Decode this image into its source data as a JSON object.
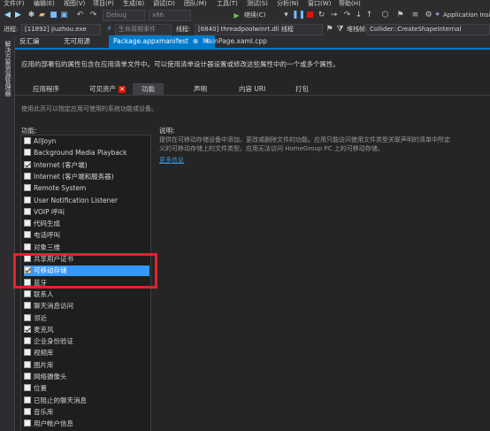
{
  "menubar": {
    "items": [
      "文件(F)",
      "编辑(E)",
      "视图(V)",
      "项目(P)",
      "生成(B)",
      "调试(D)",
      "团队(M)",
      "工具(T)",
      "测试(S)",
      "分析(N)",
      "窗口(W)",
      "帮助(H)"
    ]
  },
  "toolbar": {
    "config": "Debug",
    "platform": "x86",
    "continue": "继续(C)",
    "app_insights": "Application Insights"
  },
  "process_bar": {
    "process_label": "进程:",
    "process_value": "[11892] jiuzhou.exe",
    "lifecycle": "生命周期事件",
    "thread_label": "线程:",
    "thread_value": "[6840] threadpoolwinrt.dll 线程",
    "stack_label": "堆栈帧:",
    "stack_value": "Collider::CreateShapeInternal"
  },
  "left_strip": {
    "label": "解决方案资源管理器"
  },
  "doc_tabs": [
    {
      "label": "反汇编",
      "active": false
    },
    {
      "label": "无可用源",
      "active": false
    },
    {
      "label": "Package.appxmanifest",
      "active": true,
      "pin": "⊕",
      "close": "✕"
    },
    {
      "label": "MainPage.xaml.cpp",
      "active": false
    }
  ],
  "editor": {
    "description": "应用的部署包的属性包含在应用清单文件中。可以使用清单设计器设置或修改这些属性中的一个或多个属性。",
    "tabs": [
      "应用程序",
      "可见资产",
      "功能",
      "声明",
      "内容 URI",
      "打包"
    ],
    "active_tab": "功能",
    "error_tab": "可见资产",
    "error_mark": "✕",
    "subtitle": "使用此页可以指定应用可使用的系统功能或设备。",
    "capabilities_label": "功能:",
    "capabilities": [
      {
        "label": "AllJoyn",
        "checked": false,
        "selected": false
      },
      {
        "label": "Background Media Playback",
        "checked": false,
        "selected": false
      },
      {
        "label": "Internet (客户端)",
        "checked": true,
        "selected": false
      },
      {
        "label": "Internet (客户端和服务器)",
        "checked": false,
        "selected": false
      },
      {
        "label": "Remote System",
        "checked": false,
        "selected": false
      },
      {
        "label": "User Notification Listener",
        "checked": false,
        "selected": false
      },
      {
        "label": "VOIP 呼叫",
        "checked": false,
        "selected": false
      },
      {
        "label": "代码生成",
        "checked": false,
        "selected": false
      },
      {
        "label": "电话呼叫",
        "checked": false,
        "selected": false
      },
      {
        "label": "对象三维",
        "checked": false,
        "selected": false
      },
      {
        "label": "共享用户证书",
        "checked": false,
        "selected": false
      },
      {
        "label": "可移动存储",
        "checked": true,
        "selected": true
      },
      {
        "label": "蓝牙",
        "checked": false,
        "selected": false
      },
      {
        "label": "联系人",
        "checked": false,
        "selected": false
      },
      {
        "label": "聊天消息访问",
        "checked": false,
        "selected": false
      },
      {
        "label": "邻近",
        "checked": false,
        "selected": false
      },
      {
        "label": "麦克风",
        "checked": true,
        "selected": false
      },
      {
        "label": "企业身份验证",
        "checked": false,
        "selected": false
      },
      {
        "label": "视频库",
        "checked": false,
        "selected": false
      },
      {
        "label": "图片库",
        "checked": false,
        "selected": false
      },
      {
        "label": "网络摄像头",
        "checked": false,
        "selected": false
      },
      {
        "label": "位置",
        "checked": false,
        "selected": false
      },
      {
        "label": "已阻止的聊天消息",
        "checked": false,
        "selected": false
      },
      {
        "label": "音乐库",
        "checked": false,
        "selected": false
      },
      {
        "label": "用户帐户信息",
        "checked": false,
        "selected": false
      }
    ],
    "detail_label": "说明:",
    "detail_text_1": "提供在可移动存储设备中添加、更改或删除文件的功能。应用只能访问使用文件类型关联声明的清单中所定",
    "detail_text_2": "义的可移动存储上的文件类型。应用无法访问 HomeGroup PC 上的可移动存储。",
    "more_link": "更多信息"
  },
  "colors": {
    "accent": "#007acc",
    "selection": "#3399ff",
    "highlight_box": "#e5212b",
    "error_badge": "#e51400"
  }
}
